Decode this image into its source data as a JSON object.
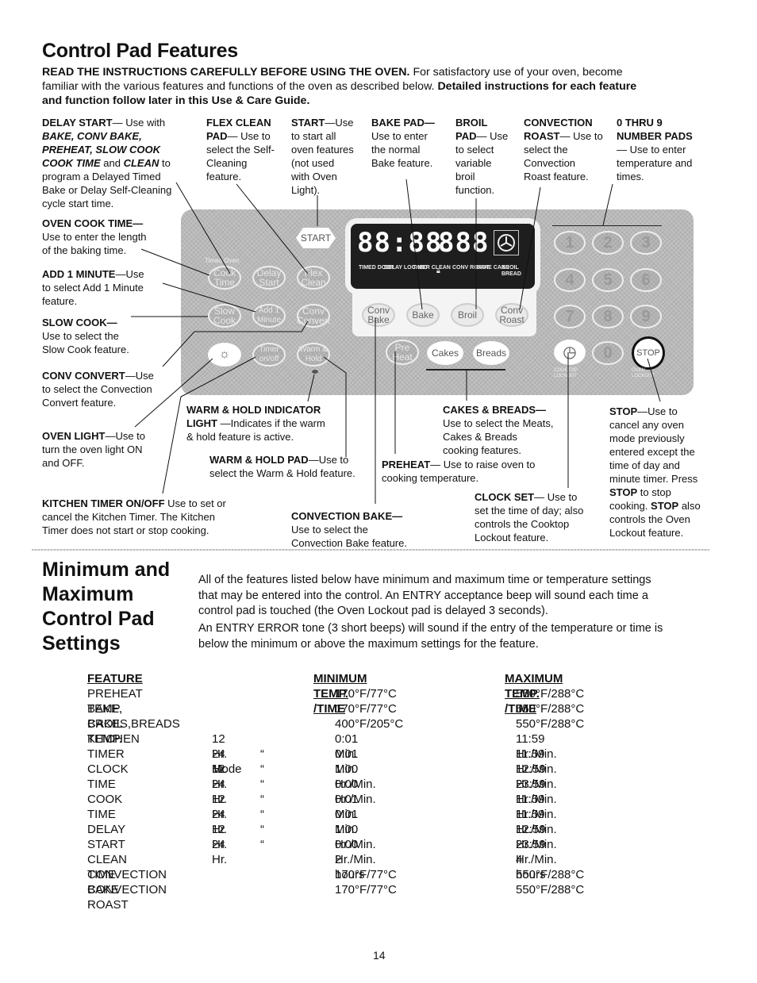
{
  "header": {
    "title": "Control Pad Features",
    "intro_bold": "READ THE INSTRUCTIONS CAREFULLY BEFORE USING THE OVEN.",
    "intro_text_1": "For satisfactory use of your oven, become",
    "intro_text_2": "familiar with the various features and functions of the oven as described below.",
    "intro_bold_2": "Detailed instructions for each feature",
    "intro_bold_3": "and function follow later in this Use & Care Guide."
  },
  "callouts": {
    "delay_start": {
      "title": "DELAY START",
      "l1": "— Use with",
      "l2": "BAKE, CONV BAKE,",
      "l3": "PREHEAT, SLOW COOK",
      "l4a": "COOK TIME",
      "l4b": " and ",
      "l4c": "CLEAN",
      "l4d": " to",
      "l5": "program a Delayed Timed",
      "l6": "Bake or Delay Self-Cleaning",
      "l7": "cycle start time."
    },
    "flex_clean": {
      "title1": "FLEX CLEAN",
      "title2": "PAD",
      "l1": "— Use to",
      "l2": "select the Self-",
      "l3": "Cleaning",
      "l4": "feature."
    },
    "start": {
      "title": "START",
      "l1": "—Use",
      "l2": "to start all",
      "l3": "oven features",
      "l4": "(not used",
      "l5": "with Oven",
      "l6": "Light)."
    },
    "bake_pad": {
      "title": "BAKE PAD—",
      "l1": "Use to enter",
      "l2": "the normal",
      "l3": "Bake feature."
    },
    "broil_pad": {
      "title1": "BROIL",
      "title2": "PAD",
      "l1": "— Use",
      "l2": "to select",
      "l3": "variable",
      "l4": "broil",
      "l5": "function."
    },
    "conv_roast": {
      "title1": "CONVECTION",
      "title2": "ROAST",
      "l1": "— Use to",
      "l2": "select the",
      "l3": "Convection",
      "l4": "Roast feature."
    },
    "number_pads": {
      "title1": "0 THRU 9",
      "title2": "NUMBER PADS",
      "l1": "— Use to enter",
      "l2": "temperature and",
      "l3": "times."
    },
    "oven_cook_time": {
      "title": "OVEN COOK TIME—",
      "l1": "Use to enter the length",
      "l2": "of the baking time."
    },
    "add_1_minute": {
      "title": "ADD 1 MINUTE",
      "l0": "—Use",
      "l1": "to select Add 1 Minute",
      "l2": "feature."
    },
    "slow_cook": {
      "title": "SLOW COOK—",
      "l1": "Use to select the",
      "l2": "Slow Cook feature."
    },
    "conv_convert": {
      "title": "CONV CONVERT",
      "l0": "—Use",
      "l1": "to select the Convection",
      "l2": "Convert feature."
    },
    "oven_light": {
      "title": "OVEN LIGHT",
      "l0": "—Use to",
      "l1": "turn the oven light ON",
      "l2": "and OFF."
    },
    "warm_hold_indicator": {
      "title1": "WARM & HOLD INDICATOR",
      "title2": "LIGHT",
      "l0": " —Indicates if the warm",
      "l1": "& hold feature is active."
    },
    "warm_hold_pad": {
      "title": "WARM & HOLD PAD",
      "l0": "—Use to",
      "l1": "select the Warm & Hold feature."
    },
    "kitchen_timer": {
      "title": "KITCHEN TIMER ON/OFF",
      "l0": " Use  to set or",
      "l1": "cancel the Kitchen Timer. The Kitchen",
      "l2": "Timer does not start or stop cooking."
    },
    "convection_bake": {
      "title": "CONVECTION BAKE—",
      "l1": "Use to select the",
      "l2": "Convection Bake feature."
    },
    "cakes_breads": {
      "title": "CAKES & BREADS—",
      "l1": "Use to select the Meats,",
      "l2": "Cakes & Breads",
      "l3": "cooking features."
    },
    "preheat": {
      "title": "PREHEAT",
      "l0": "— Use to raise oven to",
      "l1": "cooking  temperature."
    },
    "clock_set": {
      "title": "CLOCK SET",
      "l0": "— Use to",
      "l1": "set the time of day; also",
      "l2": "controls the Cooktop",
      "l3": "Lockout feature."
    },
    "stop": {
      "title": "STOP",
      "l0": "—Use to",
      "l1": "cancel any oven",
      "l2": "mode previously",
      "l3": "entered except the",
      "l4": "time of day and",
      "l5": "minute timer. Press",
      "l6a": "STOP",
      "l6b": " to stop",
      "l7a": "cooking. ",
      "l7b": "STOP",
      "l7c": " also",
      "l8": "controls the Oven",
      "l9": "Lockout feature."
    }
  },
  "panel": {
    "start_label": "START",
    "timed_oven_label": "Timed Oven",
    "pads": {
      "cook_time": "Cook Time",
      "delay_start": "Delay Start",
      "flex_clean": "Flex Clean",
      "slow_cook": "Slow Cook",
      "add_1_minute": "Add 1 Minute",
      "conv_convert": "Conv Convert",
      "timer_onoff": "Timer on/off",
      "warm_hold": "Warm & Hold",
      "conv_bake": "Conv Bake",
      "bake": "Bake",
      "broil": "Broil",
      "conv_roast": "Conv Roast",
      "preheat": "Pre Heat",
      "cakes": "Cakes",
      "breads": "Breads",
      "stop": "STOP"
    },
    "numbers": [
      "1",
      "2",
      "3",
      "4",
      "5",
      "6",
      "7",
      "8",
      "9",
      "0"
    ],
    "display": {
      "time": "88:88",
      "temp": "888",
      "labels": [
        "TIMED DOOR",
        "DELAY LOCKED",
        "TIMER CLEAN",
        "CONV ROAST",
        "BAKE CAKE",
        "BROIL BREAD"
      ]
    },
    "cooktop_lockout": "COOKTOP LOCKOUT",
    "oven_lockout": "OVEN LOCKOUT"
  },
  "section2": {
    "title_lines": [
      "Minimum and",
      "Maximum",
      "Control Pad",
      "Settings"
    ],
    "p1": [
      "All of the features listed below have minimum and maximum time or temperature settings",
      "that may be entered into the control. An ENTRY acceptance beep will sound each time a",
      "control pad is touched (the Oven Lockout  pad is delayed 3 seconds)."
    ],
    "p2": [
      "An ENTRY ERROR tone (3 short beeps) will sound if the entry of the temperature or time is",
      "below the minimum or above the maximum settings for the feature."
    ]
  },
  "settings_table": {
    "headers": [
      "FEATURE",
      "MINIMUM TEMP. /TIME",
      "MAXIMUM TEMP. /TIME"
    ],
    "rows": [
      {
        "feature": "PREHEAT TEMP.",
        "mode": "",
        "ditto": "",
        "min": "170°F/77°C",
        "max": "550°F/288°C"
      },
      {
        "feature": "BAKE, CAKES,BREADS TEMP.",
        "mode": "",
        "ditto": "",
        "min": "170°F/77°C",
        "max": "550°F/288°C"
      },
      {
        "feature": "BROIL TEMP.",
        "mode": "",
        "ditto": "",
        "min": "400°F/205°C",
        "max": "550°F/288°C"
      },
      {
        "feature": "KITCHEN TIMER",
        "mode": "12 Hr. Mode",
        "ditto": "",
        "min": "0:01 Min.",
        "max": "11:59 Hr./Min."
      },
      {
        "feature": "",
        "mode": "24 Hr.",
        "ditto": "“",
        "min": "0:01 Min.",
        "max": "11:59 Hr./Min."
      },
      {
        "feature": "CLOCK TIME",
        "mode": "12 Hr.",
        "ditto": "“",
        "min": "1:00 Hr./Min.",
        "max": "12:59 Hr./Min."
      },
      {
        "feature": "",
        "mode": "24 Hr.",
        "ditto": "“",
        "min": "0:00 Hr./Min.",
        "max": "23:59 Hr./Min."
      },
      {
        "feature": "COOK TIME",
        "mode": "12 Hr.",
        "ditto": "“",
        "min": "0:01 Min.",
        "max": "11:59 Hr./Min."
      },
      {
        "feature": "",
        "mode": "24 Hr.",
        "ditto": "“",
        "min": "0:01 Min.",
        "max": "11:59 Hr./Min."
      },
      {
        "feature": "DELAY START",
        "mode": "12 Hr.",
        "ditto": "“",
        "min": "1:00 Hr./Min.",
        "max": "12:59 Hr./Min."
      },
      {
        "feature": "",
        "mode": "24 Hr.",
        "ditto": "“",
        "min": "0:00 Hr./Min.",
        "max": "23:59 Hr./Min."
      },
      {
        "feature": "CLEAN TIME",
        "mode": "",
        "ditto": "",
        "min": "2 hours",
        "max": "4 hours"
      },
      {
        "feature": "CONVECTION BAKE",
        "mode": "",
        "ditto": "",
        "min": "170°F/77°C",
        "max": "550°F/288°C"
      },
      {
        "feature": "CONVECTION ROAST",
        "mode": "",
        "ditto": "",
        "min": "170°F/77°C",
        "max": "550°F/288°C"
      }
    ]
  },
  "page_number": "14"
}
